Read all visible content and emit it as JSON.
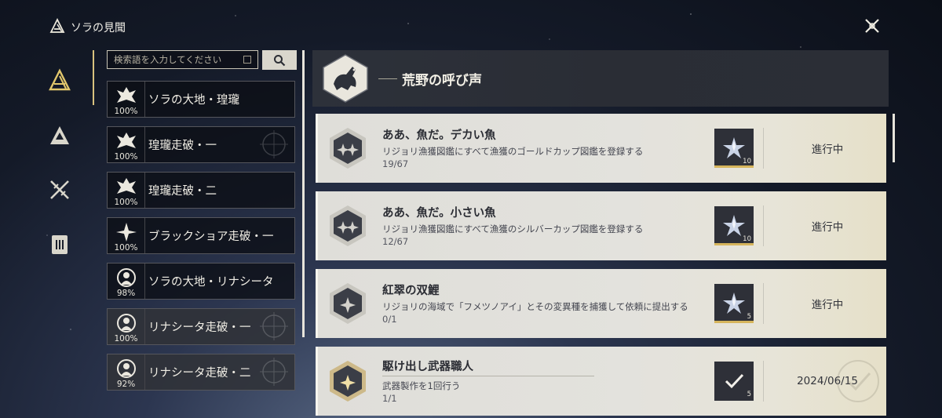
{
  "header": {
    "title": "ソラの見聞"
  },
  "nav": {
    "items": [
      "triangle-emblem-icon",
      "mountain-a-icon",
      "crossed-swords-icon",
      "book-icon"
    ]
  },
  "search": {
    "placeholder": "検索語を入力してください"
  },
  "categories": [
    {
      "label": "ソラの大地・瑝瓏",
      "percent": "100%"
    },
    {
      "label": "瑝瓏走破・一",
      "percent": "100%"
    },
    {
      "label": "瑝瓏走破・二",
      "percent": "100%"
    },
    {
      "label": "ブラックショア走破・一",
      "percent": "100%"
    },
    {
      "label": "ソラの大地・リナシータ",
      "percent": "98%"
    },
    {
      "label": "リナシータ走破・一",
      "percent": "100%"
    },
    {
      "label": "リナシータ走破・二",
      "percent": "92%"
    }
  ],
  "banner": {
    "title": "荒野の呼び声"
  },
  "achievements": [
    {
      "title": "ああ、魚だ。デカい魚",
      "desc": "リジョリ漁獲図鑑にすべて漁獲のゴールドカップ図鑑を登録する",
      "progress": "19/67",
      "reward_count": "10",
      "status": "進行中"
    },
    {
      "title": "ああ、魚だ。小さい魚",
      "desc": "リジョリ漁獲図鑑にすべて漁獲のシルバーカップ図鑑を登録する",
      "progress": "12/67",
      "reward_count": "10",
      "status": "進行中"
    },
    {
      "title": "紅翠の双鯉",
      "desc": "リジョリの海域で「フメツノアイ」とその変異種を捕獲して依頼に提出する",
      "progress": "0/1",
      "reward_count": "5",
      "status": "進行中"
    },
    {
      "title": "駆け出し武器職人",
      "desc": "武器製作を1回行う",
      "progress": "1/1",
      "reward_count": "5",
      "status": "2024/06/15"
    }
  ],
  "colors": {
    "accent_gold": "#d6b55c",
    "card_bg": "#e3e2dd",
    "panel_dark": "#2d313a"
  }
}
